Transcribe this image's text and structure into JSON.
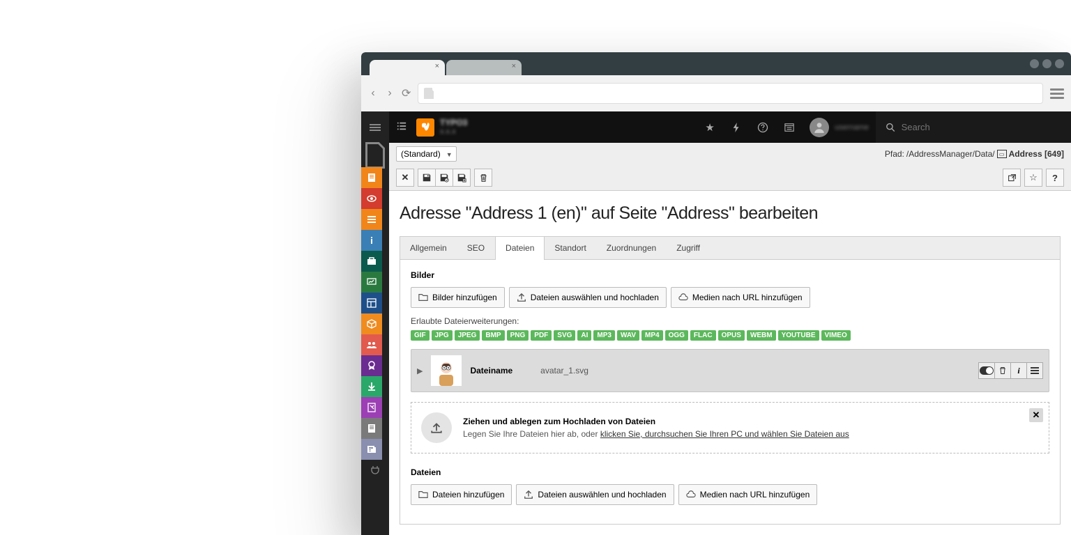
{
  "search_placeholder": "Search",
  "selector": "(Standard)",
  "path_label": "Pfad:",
  "path": "/AddressManager/Data/",
  "path_record": "Address [649]",
  "page_title": "Adresse \"Address 1 (en)\" auf Seite \"Address\" bearbeiten",
  "tabs": {
    "general": "Allgemein",
    "seo": "SEO",
    "files": "Dateien",
    "location": "Standort",
    "mappings": "Zuordnungen",
    "access": "Zugriff"
  },
  "section_images": "Bilder",
  "btn_add_images": "Bilder hinzufügen",
  "btn_upload_files": "Dateien auswählen und hochladen",
  "btn_add_media_url": "Medien nach URL hinzufügen",
  "allowed_ext_label": "Erlaubte Dateierweiterungen:",
  "ext": [
    "GIF",
    "JPG",
    "JPEG",
    "BMP",
    "PNG",
    "PDF",
    "SVG",
    "AI",
    "MP3",
    "WAV",
    "MP4",
    "OGG",
    "FLAC",
    "OPUS",
    "WEBM",
    "YOUTUBE",
    "VIMEO"
  ],
  "file_label": "Dateiname",
  "file_name": "avatar_1.svg",
  "dz_title": "Ziehen und ablegen zum Hochladen von Dateien",
  "dz_sub_pre": "Legen Sie Ihre Dateien hier ab, oder ",
  "dz_sub_link": "klicken Sie, durchsuchen Sie Ihren PC und wählen Sie Dateien aus",
  "section_files": "Dateien",
  "btn_add_files": "Dateien hinzufügen"
}
